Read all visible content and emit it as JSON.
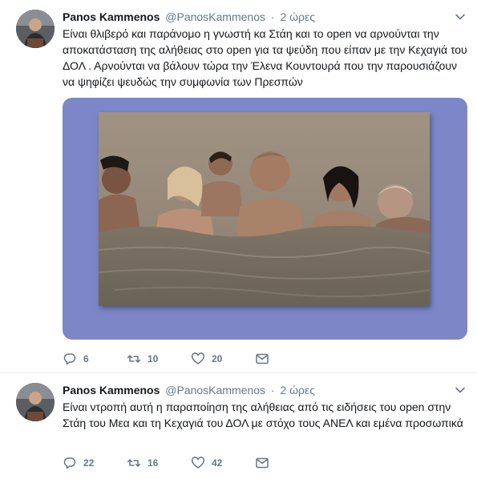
{
  "tweets": [
    {
      "author_name": "Panos Kammenos",
      "author_handle": "@PanosKammenos",
      "separator": "·",
      "time": "2 ώρες",
      "text": "Είναι θλιβερό και παράνομο η γνωστή κα Στάη και το open να αρνούνται την αποκατάσταση της αλήθειας στο open για τα ψεύδη που είπαν με την Κεχαγιά του ΔΟΛ . Αρνούνται να βάλουν τώρα την Έλενα Κουντουρά που την παρουσιάζουν να ψηφίζει ψευδώς την συμφωνία των Πρεσπών",
      "replies": "6",
      "retweets": "10",
      "likes": "20",
      "media_background": "#7d87c8"
    },
    {
      "author_name": "Panos Kammenos",
      "author_handle": "@PanosKammenos",
      "separator": "·",
      "time": "2 ώρες",
      "text": "Είναι ντροπή αυτή η παραποίηση της αλήθειας από τις ειδήσεις του open στην Στάη του Mεα και τη Κεχαγιά του ΔΟΛ με στόχο τους ΑΝΕΛ και εμένα προσωπικά",
      "replies": "22",
      "retweets": "16",
      "likes": "42"
    }
  ],
  "icons": {
    "reply": "reply-icon",
    "retweet": "retweet-icon",
    "like": "heart-icon",
    "message": "envelope-icon",
    "more": "chevron-down-icon"
  },
  "colors": {
    "text": "#14171a",
    "secondary": "#657786",
    "divider": "#e6ecf0"
  }
}
